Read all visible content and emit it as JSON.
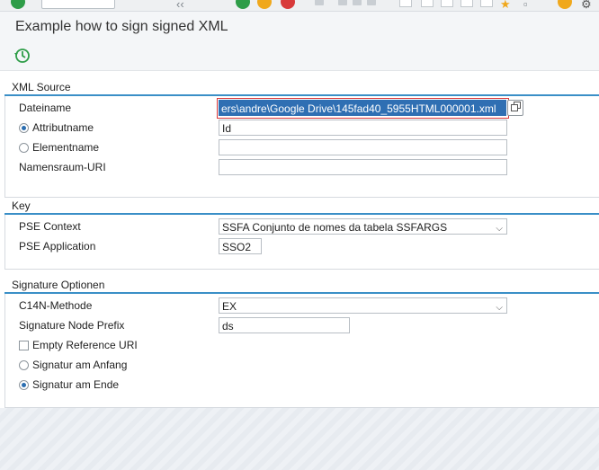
{
  "header": {
    "title": "Example how to sign signed XML"
  },
  "groups": {
    "xml_source": {
      "title": "XML Source",
      "dateiname_label": "Dateiname",
      "dateiname_value": "ers\\andre\\Google Drive\\145fad40_5955HTML000001.xml",
      "attributname_label": "Attributname",
      "attributname_value": "Id",
      "attributname_selected": true,
      "elementname_label": "Elementname",
      "elementname_value": "",
      "namensraum_label": "Namensraum-URI",
      "namensraum_value": ""
    },
    "key": {
      "title": "Key",
      "pse_context_label": "PSE Context",
      "pse_context_value": "SSFA Conjunto de nomes da tabela SSFARGS",
      "pse_application_label": "PSE Application",
      "pse_application_value": "SSO2"
    },
    "signature": {
      "title": "Signature Optionen",
      "c14n_label": "C14N-Methode",
      "c14n_value": "EX",
      "node_prefix_label": "Signature Node Prefix",
      "node_prefix_value": "ds",
      "empty_ref_label": "Empty Reference URI",
      "empty_ref_checked": false,
      "anfang_label": "Signatur am Anfang",
      "anfang_selected": false,
      "ende_label": "Signatur am Ende",
      "ende_selected": true
    }
  },
  "icons": {
    "execute": "execute-icon",
    "value_help": "value-help-icon",
    "dropdown": "chevron-down-icon"
  },
  "colors": {
    "group_line": "#3a8fc7",
    "selection": "#2f6fb3",
    "focus": "#d9383a"
  }
}
